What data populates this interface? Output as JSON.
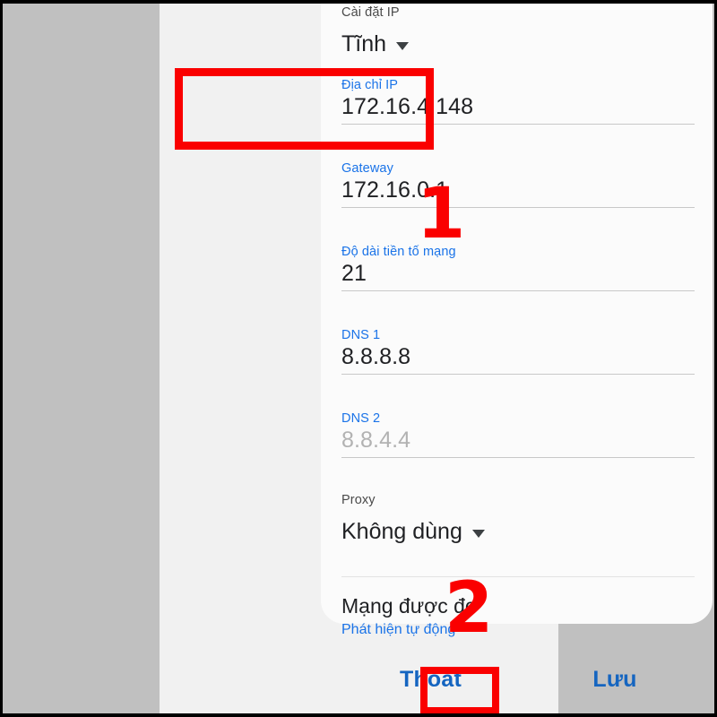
{
  "dialog": {
    "ip_settings": {
      "label": "Cài đặt IP",
      "value": "Tĩnh",
      "caret_icon": "chevron-down-icon"
    },
    "fields": [
      {
        "key": "ip_address",
        "label": "Địa chỉ IP",
        "value": "172.16.4.148",
        "is_placeholder": false
      },
      {
        "key": "gateway",
        "label": "Gateway",
        "value": "172.16.0.1",
        "is_placeholder": false
      },
      {
        "key": "prefix_length",
        "label": "Độ dài tiền tố mạng",
        "value": "21",
        "is_placeholder": false
      },
      {
        "key": "dns1",
        "label": "DNS 1",
        "value": "8.8.8.8",
        "is_placeholder": false
      },
      {
        "key": "dns2",
        "label": "DNS 2",
        "value": "8.8.4.4",
        "is_placeholder": true
      }
    ],
    "proxy": {
      "label": "Proxy",
      "value": "Không dùng",
      "caret_icon": "chevron-down-icon"
    },
    "metered": {
      "title": "Mạng được đo",
      "subtitle": "Phát hiện tự động"
    }
  },
  "actions": {
    "exit_label": "Thoát",
    "save_label": "Lưu"
  },
  "annotations": {
    "step_one": "1",
    "step_two": "2"
  },
  "colors": {
    "accent_blue": "#1a73e8",
    "button_blue": "#1565c0",
    "annotation_red": "#fa0000",
    "card_background": "#fbfbfb",
    "screen_background": "#f1f1f1",
    "outer_background": "#c0c0c0",
    "placeholder_gray": "#b2b2b2"
  }
}
